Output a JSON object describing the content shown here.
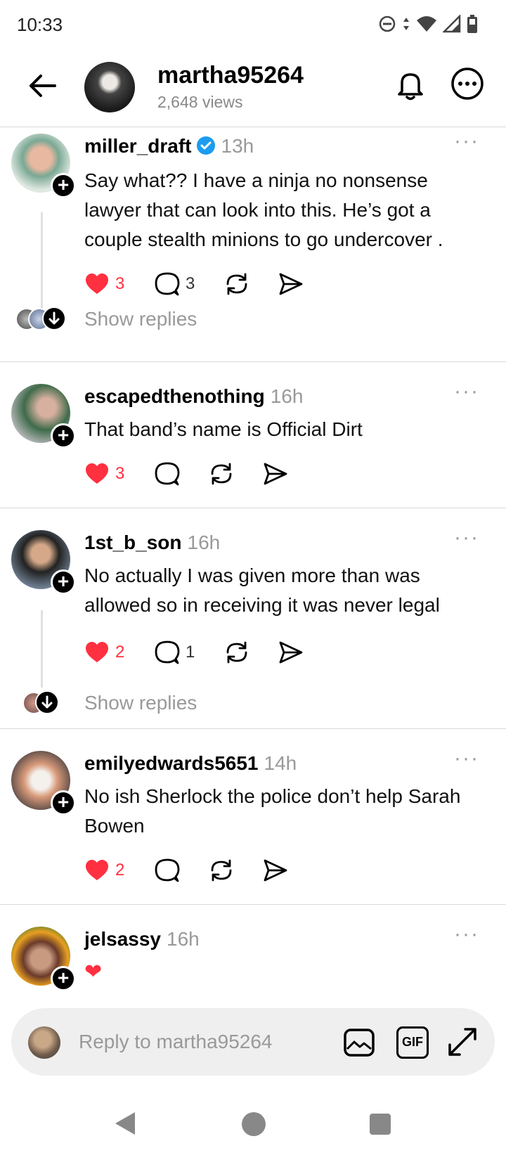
{
  "status_bar": {
    "time": "10:33"
  },
  "header": {
    "username": "martha95264",
    "views": "2,648 views"
  },
  "posts": [
    {
      "username": "miller_draft",
      "time": "13h",
      "verified": true,
      "text": "Say what?? I have a ninja no nonsense lawyer that can look into this. He’s got a couple stealth minions to go undercover .",
      "likes": "3",
      "replies": "3",
      "show_replies": "Show replies"
    },
    {
      "username": "escapedthenothing",
      "time": "16h",
      "text": "That band’s name is Official Dirt",
      "likes": "3"
    },
    {
      "username": "1st_b_son",
      "time": "16h",
      "text": "No actually I was given more than was allowed so in receiving it was never legal",
      "likes": "2",
      "replies": "1",
      "show_replies": "Show replies"
    },
    {
      "username": "emilyedwards5651",
      "time": "14h",
      "text": "No ish Sherlock the police don’t help Sarah Bowen",
      "likes": "2"
    },
    {
      "username": "jelsassy",
      "time": "16h",
      "text": "❤"
    }
  ],
  "reply_bar": {
    "placeholder": "Reply to martha95264",
    "gif_label": "GIF"
  },
  "colors": {
    "like_red": "#ff3040",
    "verified_blue": "#1d9bf0",
    "muted_gray": "#999999"
  }
}
